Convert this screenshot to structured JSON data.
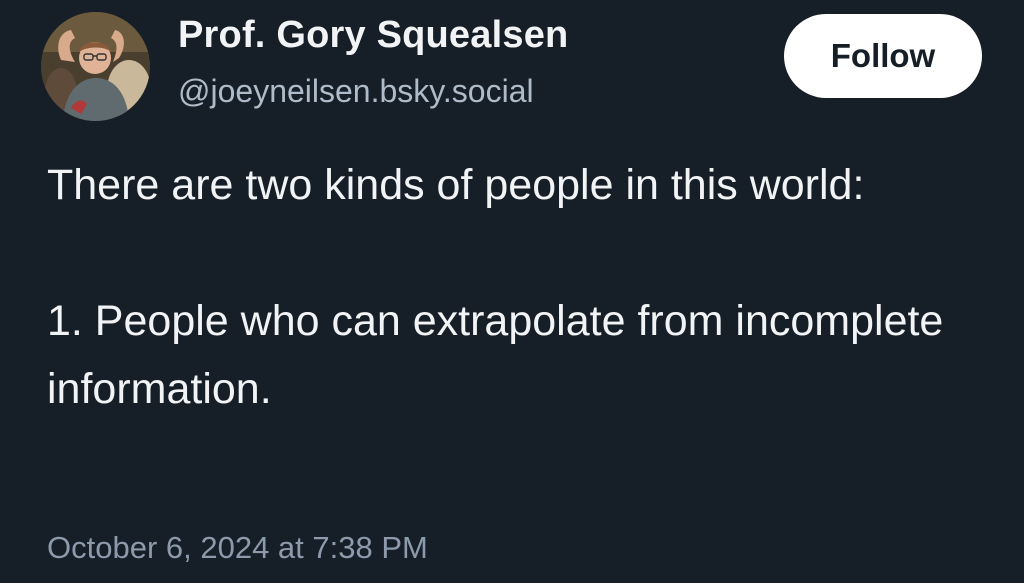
{
  "author": {
    "display_name": "Prof. Gory Squealsen",
    "handle": "@joeyneilsen.bsky.social",
    "avatar_icon": "profile-photo"
  },
  "follow_button": {
    "label": "Follow"
  },
  "post": {
    "paragraphs": [
      "There are two kinds of people in this world:",
      "1. People who can extrapolate from incomplete information."
    ],
    "timestamp": "October 6, 2024 at 7:38 PM"
  },
  "colors": {
    "background": "#161e27",
    "text": "#f1f3f5",
    "handle": "#aebbc9",
    "timestamp": "#8c9aab",
    "button_bg": "#ffffff",
    "button_text": "#161e27"
  }
}
